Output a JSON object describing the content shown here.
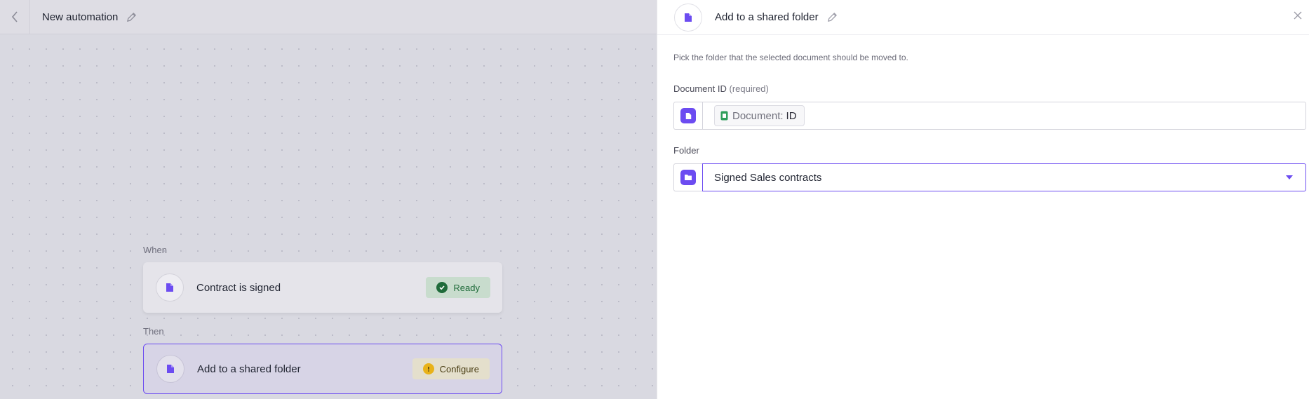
{
  "header": {
    "title": "New automation"
  },
  "flow": {
    "when_label": "When",
    "then_label": "Then",
    "trigger": {
      "title": "Contract is signed",
      "status": "Ready"
    },
    "action": {
      "title": "Add to a shared folder",
      "status": "Configure"
    }
  },
  "panel": {
    "title": "Add to a shared folder",
    "description": "Pick the folder that the selected document should be moved to.",
    "document_id": {
      "label": "Document ID",
      "required": "(required)",
      "token_key": "Document:",
      "token_value": "ID"
    },
    "folder": {
      "label": "Folder",
      "value": "Signed Sales contracts"
    }
  },
  "colors": {
    "accent": "#6c4cf1",
    "ready_green": "#1f6b3a",
    "configure_yellow": "#e8b21a"
  },
  "icons": [
    "chevron-left-icon",
    "pencil-icon",
    "document-icon",
    "check-circle-icon",
    "warning-icon",
    "close-icon",
    "folder-icon",
    "caret-down-icon"
  ]
}
